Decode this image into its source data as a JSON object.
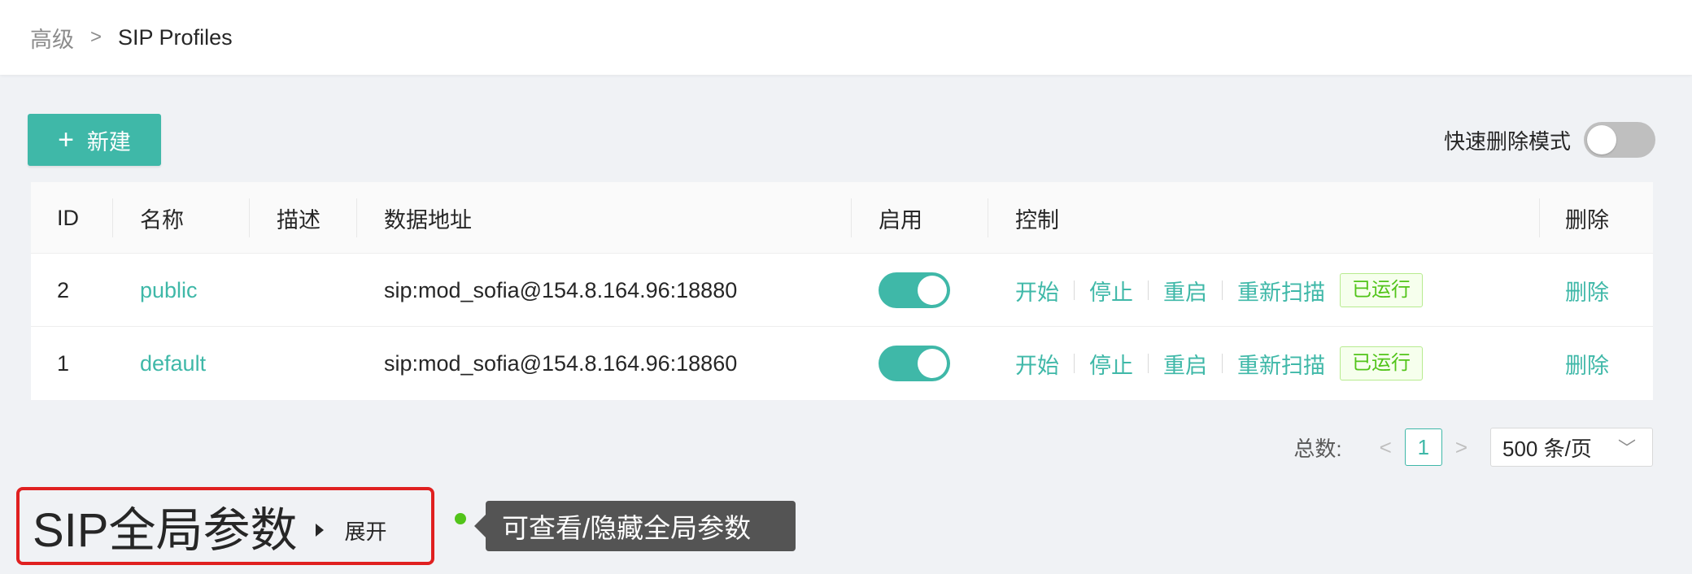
{
  "breadcrumb": {
    "parent": "高级",
    "separator": ">",
    "current": "SIP Profiles"
  },
  "toolbar": {
    "new_button": "新建",
    "quick_delete_label": "快速删除模式",
    "quick_delete_on": false
  },
  "table": {
    "columns": [
      "ID",
      "名称",
      "描述",
      "数据地址",
      "启用",
      "控制",
      "删除"
    ],
    "rows": [
      {
        "id": "2",
        "name": "public",
        "desc": "",
        "address": "sip:mod_sofia@154.8.164.96:18880",
        "enabled": true,
        "controls": [
          "开始",
          "停止",
          "重启",
          "重新扫描"
        ],
        "status": "已运行",
        "delete": "删除"
      },
      {
        "id": "1",
        "name": "default",
        "desc": "",
        "address": "sip:mod_sofia@154.8.164.96:18860",
        "enabled": true,
        "controls": [
          "开始",
          "停止",
          "重启",
          "重新扫描"
        ],
        "status": "已运行",
        "delete": "删除"
      }
    ]
  },
  "pagination": {
    "total_label": "总数:",
    "current_page": "1",
    "page_size": "500 条/页"
  },
  "global_params": {
    "title": "SIP全局参数",
    "expand_label": "展开",
    "tooltip": "可查看/隐藏全局参数"
  },
  "colors": {
    "accent": "#3fb8a8",
    "highlight_border": "#e02020",
    "status_green": "#52c41a",
    "tooltip_bg": "#545454"
  }
}
